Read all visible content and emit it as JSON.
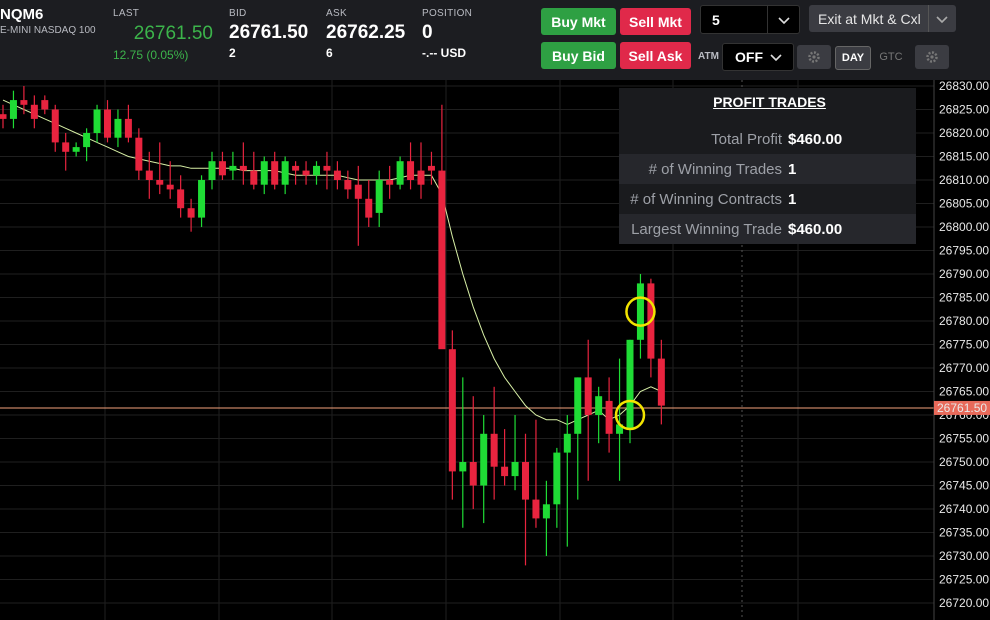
{
  "instrument": {
    "symbol": "NQM6",
    "description": "E-MINI NASDAQ 100"
  },
  "quotes": {
    "last": {
      "label": "LAST",
      "value": "26761.50",
      "change": "12.75 (0.05%)"
    },
    "bid": {
      "label": "BID",
      "value": "26761.50",
      "size": "2"
    },
    "ask": {
      "label": "ASK",
      "value": "26762.25",
      "size": "6"
    },
    "position": {
      "label": "POSITION",
      "value": "0",
      "pnl": "-.-- USD"
    }
  },
  "order_entry": {
    "buy_mkt": "Buy Mkt",
    "sell_mkt": "Sell Mkt",
    "buy_bid": "Buy Bid",
    "sell_ask": "Sell Ask",
    "quantity": "5",
    "exit_button": "Exit at Mkt & Cxl",
    "atm_label": "ATM",
    "atm_value": "OFF",
    "tif_day": "DAY",
    "tif_gtc": "GTC"
  },
  "profit_panel": {
    "title": "PROFIT TRADES",
    "rows": [
      {
        "label": "Total Profit",
        "value": "$460.00"
      },
      {
        "label": "# of Winning Trades",
        "value": "1"
      },
      {
        "label": "# of Winning Contracts",
        "value": "1"
      },
      {
        "label": "Largest Winning Trade",
        "value": "$460.00"
      }
    ]
  },
  "colors": {
    "up": "#1fdc35",
    "down": "#e8243f",
    "ma": "#d8f0a6",
    "price_line": "#f4a27c",
    "price_tag": "#e86a5a",
    "marker": "#f2e300"
  },
  "chart_data": {
    "type": "candlestick",
    "y_ticks": [
      26830,
      26825,
      26820,
      26815,
      26810,
      26805,
      26800,
      26795,
      26790,
      26785,
      26780,
      26775,
      26770,
      26765,
      26760,
      26755,
      26750,
      26745,
      26740,
      26735,
      26730,
      26725,
      26720
    ],
    "ylim": [
      26718,
      26832
    ],
    "current_price": "26761.50",
    "candles": [
      [
        26824,
        26826,
        26821,
        26823
      ],
      [
        26823,
        26829,
        26821,
        26827
      ],
      [
        26827,
        26830,
        26824,
        26826
      ],
      [
        26826,
        26828,
        26821,
        26823
      ],
      [
        26827,
        26828,
        26824,
        26825
      ],
      [
        26825,
        26826,
        26816,
        26818
      ],
      [
        26818,
        26820,
        26812,
        26816
      ],
      [
        26816,
        26818,
        26815,
        26817
      ],
      [
        26817,
        26821,
        26814,
        26820
      ],
      [
        26820,
        26826,
        26818,
        26825
      ],
      [
        26825,
        26827,
        26818,
        26819
      ],
      [
        26819,
        26825,
        26817,
        26823
      ],
      [
        26823,
        26826,
        26818,
        26819
      ],
      [
        26819,
        26821,
        26810,
        26812
      ],
      [
        26812,
        26816,
        26806,
        26810
      ],
      [
        26810,
        26818,
        26807,
        26809
      ],
      [
        26809,
        26814,
        26806,
        26808
      ],
      [
        26808,
        26811,
        26802,
        26804
      ],
      [
        26804,
        26806,
        26799,
        26802
      ],
      [
        26802,
        26811,
        26800,
        26810
      ],
      [
        26810,
        26816,
        26808,
        26814
      ],
      [
        26814,
        26816,
        26810,
        26811
      ],
      [
        26812,
        26816,
        26810,
        26813
      ],
      [
        26813,
        26818,
        26809,
        26812
      ],
      [
        26812,
        26816,
        26808,
        26809
      ],
      [
        26809,
        26815,
        26807,
        26814
      ],
      [
        26814,
        26816,
        26808,
        26809
      ],
      [
        26809,
        26815,
        26807,
        26814
      ],
      [
        26813,
        26814,
        26809,
        26812
      ],
      [
        26812,
        26814,
        26809,
        26811
      ],
      [
        26811,
        26814,
        26809,
        26813
      ],
      [
        26813,
        26816,
        26808,
        26812
      ],
      [
        26812,
        26814,
        26808,
        26810
      ],
      [
        26810,
        26812,
        26806,
        26808
      ],
      [
        26809,
        26813,
        26796,
        26806
      ],
      [
        26806,
        26810,
        26800,
        26802
      ],
      [
        26803,
        26812,
        26800,
        26810
      ],
      [
        26810,
        26813,
        26806,
        26809
      ],
      [
        26809,
        26815,
        26808,
        26814
      ],
      [
        26814,
        26818,
        26808,
        26810
      ],
      [
        26812,
        26818,
        26806,
        26809
      ],
      [
        26813,
        26816,
        26809,
        26812
      ],
      [
        26812,
        26826,
        26775,
        26774
      ],
      [
        26774,
        26778,
        26742,
        26748
      ],
      [
        26748,
        26768,
        26736,
        26750
      ],
      [
        26750,
        26764,
        26740,
        26745
      ],
      [
        26745,
        26760,
        26737,
        26756
      ],
      [
        26756,
        26766,
        26742,
        26749
      ],
      [
        26749,
        26757,
        26745,
        26747
      ],
      [
        26747,
        26760,
        26744,
        26750
      ],
      [
        26750,
        26756,
        26728,
        26742
      ],
      [
        26742,
        26759,
        26736,
        26738
      ],
      [
        26738,
        26746,
        26730,
        26741
      ],
      [
        26741,
        26753,
        26736,
        26752
      ],
      [
        26752,
        26760,
        26732,
        26756
      ],
      [
        26756,
        26768,
        26742,
        26768
      ],
      [
        26768,
        26776,
        26746,
        26760
      ],
      [
        26760,
        26766,
        26754,
        26764
      ],
      [
        26763,
        26768,
        26752,
        26756
      ],
      [
        26756,
        26772,
        26746,
        26758
      ],
      [
        26757,
        26776,
        26754,
        26776
      ],
      [
        26776,
        26790,
        26772,
        26788
      ],
      [
        26788,
        26789,
        26768,
        26772
      ],
      [
        26772,
        26776,
        26758,
        26762
      ]
    ],
    "moving_average": [
      26827,
      26826,
      26825,
      26824,
      26823,
      26822,
      26821,
      26820,
      26819,
      26818,
      26817,
      26816,
      26815,
      26814.5,
      26814,
      26813.5,
      26813,
      26813,
      26812.5,
      26812.5,
      26812.5,
      26812.5,
      26812.5,
      26812,
      26812,
      26812,
      26812,
      26811.5,
      26811,
      26811,
      26811,
      26811,
      26811,
      26810.5,
      26810,
      26810,
      26810,
      26810,
      26810.5,
      26811,
      26811,
      26811,
      26807,
      26798,
      26790,
      26783,
      26777,
      26772,
      26768,
      26765,
      26762,
      26760,
      26759,
      26759,
      26758,
      26759,
      26760,
      26761,
      26759,
      26760,
      26762,
      26765,
      26766,
      26765
    ]
  }
}
